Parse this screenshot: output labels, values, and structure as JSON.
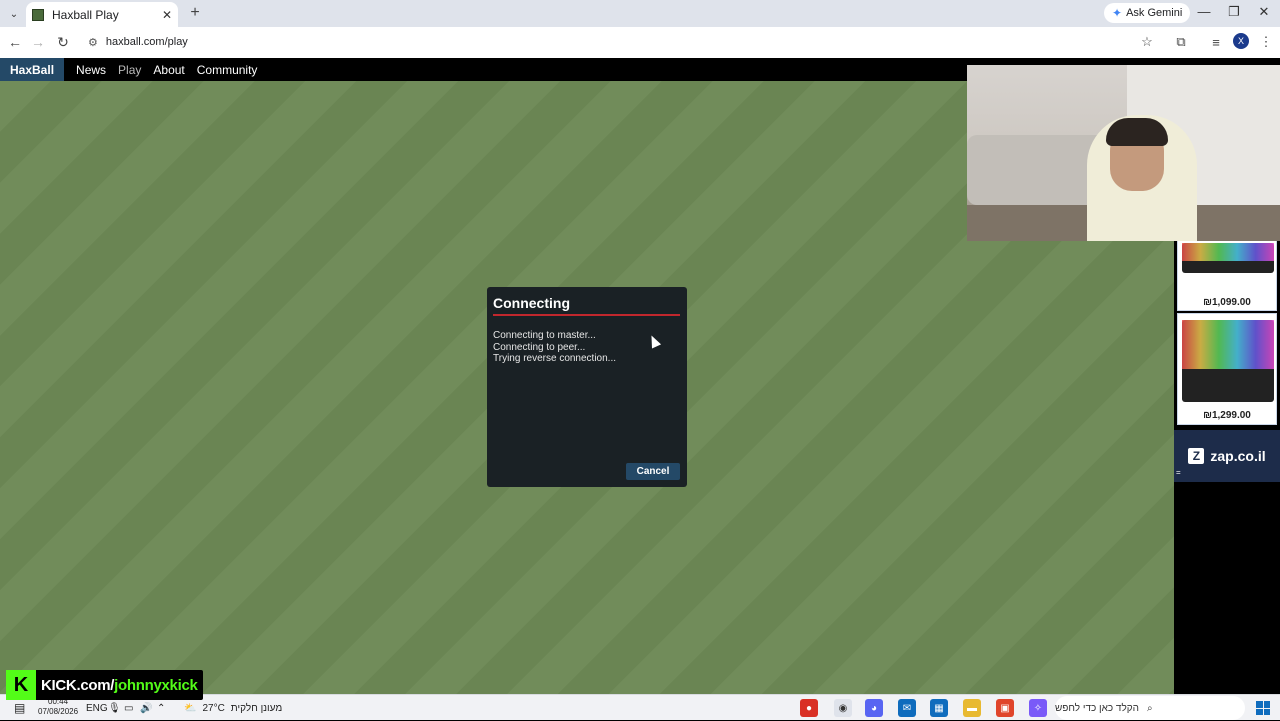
{
  "browser": {
    "tab_title": "Haxball Play",
    "tab_close": "✕",
    "new_tab": "+",
    "ask_gemini": "Ask Gemini",
    "url": "haxball.com/play",
    "window_controls": [
      "—",
      "❐",
      "✕"
    ]
  },
  "site_nav": {
    "logo": "HaxBall",
    "links": [
      "News",
      "Play",
      "About",
      "Community"
    ],
    "active": "Play"
  },
  "dialog": {
    "title": "Connecting",
    "log_lines": [
      "Connecting to master...",
      "Connecting to peer...",
      "Trying reverse connection..."
    ],
    "cancel_label": "Cancel",
    "accent": "#c1272d"
  },
  "ads": {
    "prices": [
      "₪1,099.00",
      "₪1,299.00"
    ],
    "brand": "zap.co.il",
    "brand_mark": "Z",
    "footer_mark": "="
  },
  "taskbar": {
    "time": "00:44",
    "date": "07/08/2026",
    "lang": "ENG",
    "weather_temp": "27°C",
    "weather_text": "מעונן חלקית",
    "search_placeholder": "הקלד כאן כדי לחפש"
  },
  "overlay": {
    "kick_letter": "K",
    "kick_prefix": "KICK.com/",
    "kick_user": "johnnyxkick",
    "brand_color": "#53fc18"
  },
  "icons": [
    "tab-search-icon",
    "back-icon",
    "forward-icon",
    "reload-icon",
    "site-info-icon",
    "bookmark-star-icon",
    "extensions-icon",
    "media-icon",
    "menu-icon",
    "windows-start-icon",
    "search-icon"
  ]
}
